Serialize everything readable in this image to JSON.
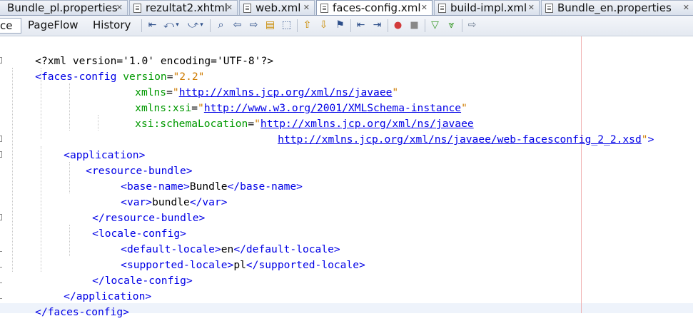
{
  "tabs": [
    {
      "label": "Bundle_pl.properties",
      "close": "✕"
    },
    {
      "label": "rezultat2.xhtml",
      "close": "✕"
    },
    {
      "label": "web.xml",
      "close": "✕"
    },
    {
      "label": "faces-config.xml",
      "close": "✕"
    },
    {
      "label": "build-impl.xml",
      "close": "✕"
    },
    {
      "label": "Bundle_en.properties",
      "close": "✕"
    }
  ],
  "toolbar": {
    "views": [
      "ce",
      "PageFlow",
      "History"
    ],
    "active_view": "ce",
    "icons": [
      "last-edit-icon",
      "back-icon",
      "forward-icon",
      "find-selection-icon",
      "find-previous-icon",
      "find-next-icon",
      "toggle-highlight-icon",
      "toggle-rectangular-selection-icon",
      "previous-bookmark-icon",
      "next-bookmark-icon",
      "toggle-bookmark-icon",
      "shift-left-icon",
      "shift-right-icon",
      "start-macro-icon",
      "stop-macro-icon",
      "check-xml-icon",
      "validate-xml-icon",
      "xsl-transform-icon"
    ]
  },
  "code": {
    "l1": {
      "decl": "<?xml version='1.0' encoding='UTF-8'?>"
    },
    "l2": {
      "open": "<faces-config",
      "attr": "version",
      "eq": "=",
      "val": "\"2.2\""
    },
    "l3": {
      "attr": "xmlns",
      "eq": "=",
      "q1": "\"",
      "url": "http://xmlns.jcp.org/xml/ns/javaee",
      "q2": "\""
    },
    "l4": {
      "attr": "xmlns:xsi",
      "eq": "=",
      "q1": "\"",
      "url": "http://www.w3.org/2001/XMLSchema-instance",
      "q2": "\""
    },
    "l5": {
      "attr": "xsi:schemaLocation",
      "eq": "=",
      "q1": "\"",
      "url": "http://xmlns.jcp.org/xml/ns/javaee"
    },
    "l6": {
      "url": "http://xmlns.jcp.org/xml/ns/javaee/web-facesconfig_2_2.xsd",
      "q2": "\"",
      "close": ">"
    },
    "l7": {
      "tag": "<application>"
    },
    "l8": {
      "tag": "<resource-bundle>"
    },
    "l9": {
      "open": "<base-name>",
      "text": "Bundle",
      "close": "</base-name>"
    },
    "l10": {
      "open": "<var>",
      "text": "bundle",
      "close": "</var>"
    },
    "l11": {
      "tag": "</resource-bundle>"
    },
    "l12": {
      "tag": "<locale-config>"
    },
    "l13": {
      "open": "<default-locale>",
      "text": "en",
      "close": "</default-locale>"
    },
    "l14": {
      "open": "<supported-locale>",
      "text": "pl",
      "close": "</supported-locale>"
    },
    "l15": {
      "tag": "</locale-config>"
    },
    "l16": {
      "tag": "</application>"
    },
    "l17": {
      "tag": "</faces-config>"
    }
  }
}
